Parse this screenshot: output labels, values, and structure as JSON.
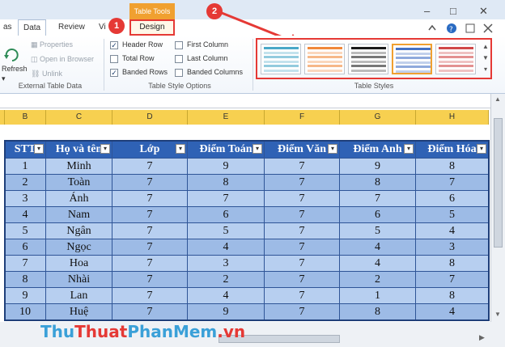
{
  "ribbon": {
    "tabs": [
      "as",
      "Data",
      "Review",
      "Vi"
    ],
    "context_header": "Table Tools",
    "context_tab": "Design",
    "external": {
      "refresh": "Refresh",
      "properties": "Properties",
      "open_in_browser": "Open in Browser",
      "unlink": "Unlink",
      "group_label": "External Table Data"
    },
    "style_options": {
      "header_row": "Header Row",
      "total_row": "Total Row",
      "banded_rows": "Banded Rows",
      "first_column": "First Column",
      "last_column": "Last Column",
      "banded_columns": "Banded Columns",
      "group_label": "Table Style Options",
      "checked": {
        "header_row": true,
        "total_row": false,
        "banded_rows": true,
        "first_column": false,
        "last_column": false,
        "banded_columns": false
      }
    },
    "table_styles": {
      "group_label": "Table Styles",
      "swatch_colors": [
        "#4aa8c8",
        "#f0883a",
        "#1a1a1a",
        "#4472c4",
        "#d04848"
      ],
      "selected_index": 3
    }
  },
  "callouts": {
    "one": "1",
    "two": "2"
  },
  "window_buttons": {
    "minimize": "–",
    "restore": "□",
    "close": "✕"
  },
  "sheet": {
    "column_letters": [
      "B",
      "C",
      "D",
      "E",
      "F",
      "G",
      "H"
    ],
    "headers": [
      "STT",
      "Họ và tên",
      "Lớp",
      "Điểm Toán",
      "Điểm Văn",
      "Điểm Anh",
      "Điểm Hóa"
    ],
    "rows": [
      [
        "1",
        "Minh",
        "7",
        "9",
        "7",
        "9",
        "8"
      ],
      [
        "2",
        "Toàn",
        "7",
        "8",
        "7",
        "8",
        "7"
      ],
      [
        "3",
        "Ánh",
        "7",
        "7",
        "7",
        "7",
        "6"
      ],
      [
        "4",
        "Nam",
        "7",
        "6",
        "7",
        "6",
        "5"
      ],
      [
        "5",
        "Ngân",
        "7",
        "5",
        "7",
        "5",
        "4"
      ],
      [
        "6",
        "Ngọc",
        "7",
        "4",
        "7",
        "4",
        "3"
      ],
      [
        "7",
        "Hoa",
        "7",
        "3",
        "7",
        "4",
        "8"
      ],
      [
        "8",
        "Nhài",
        "7",
        "2",
        "7",
        "2",
        "7"
      ],
      [
        "9",
        "Lan",
        "7",
        "4",
        "7",
        "1",
        "8"
      ],
      [
        "10",
        "Huệ",
        "7",
        "9",
        "7",
        "8",
        "4"
      ]
    ]
  },
  "watermark": {
    "part1": "Thu",
    "part2": "Thuat",
    "part3": "PhanMem",
    "part4": ".vn"
  },
  "colors": {
    "accent": "#e53935",
    "table_header": "#2f62b5",
    "band_light": "#b7cff0",
    "band_dark": "#9dbbe6",
    "col_head": "#f7d050"
  }
}
